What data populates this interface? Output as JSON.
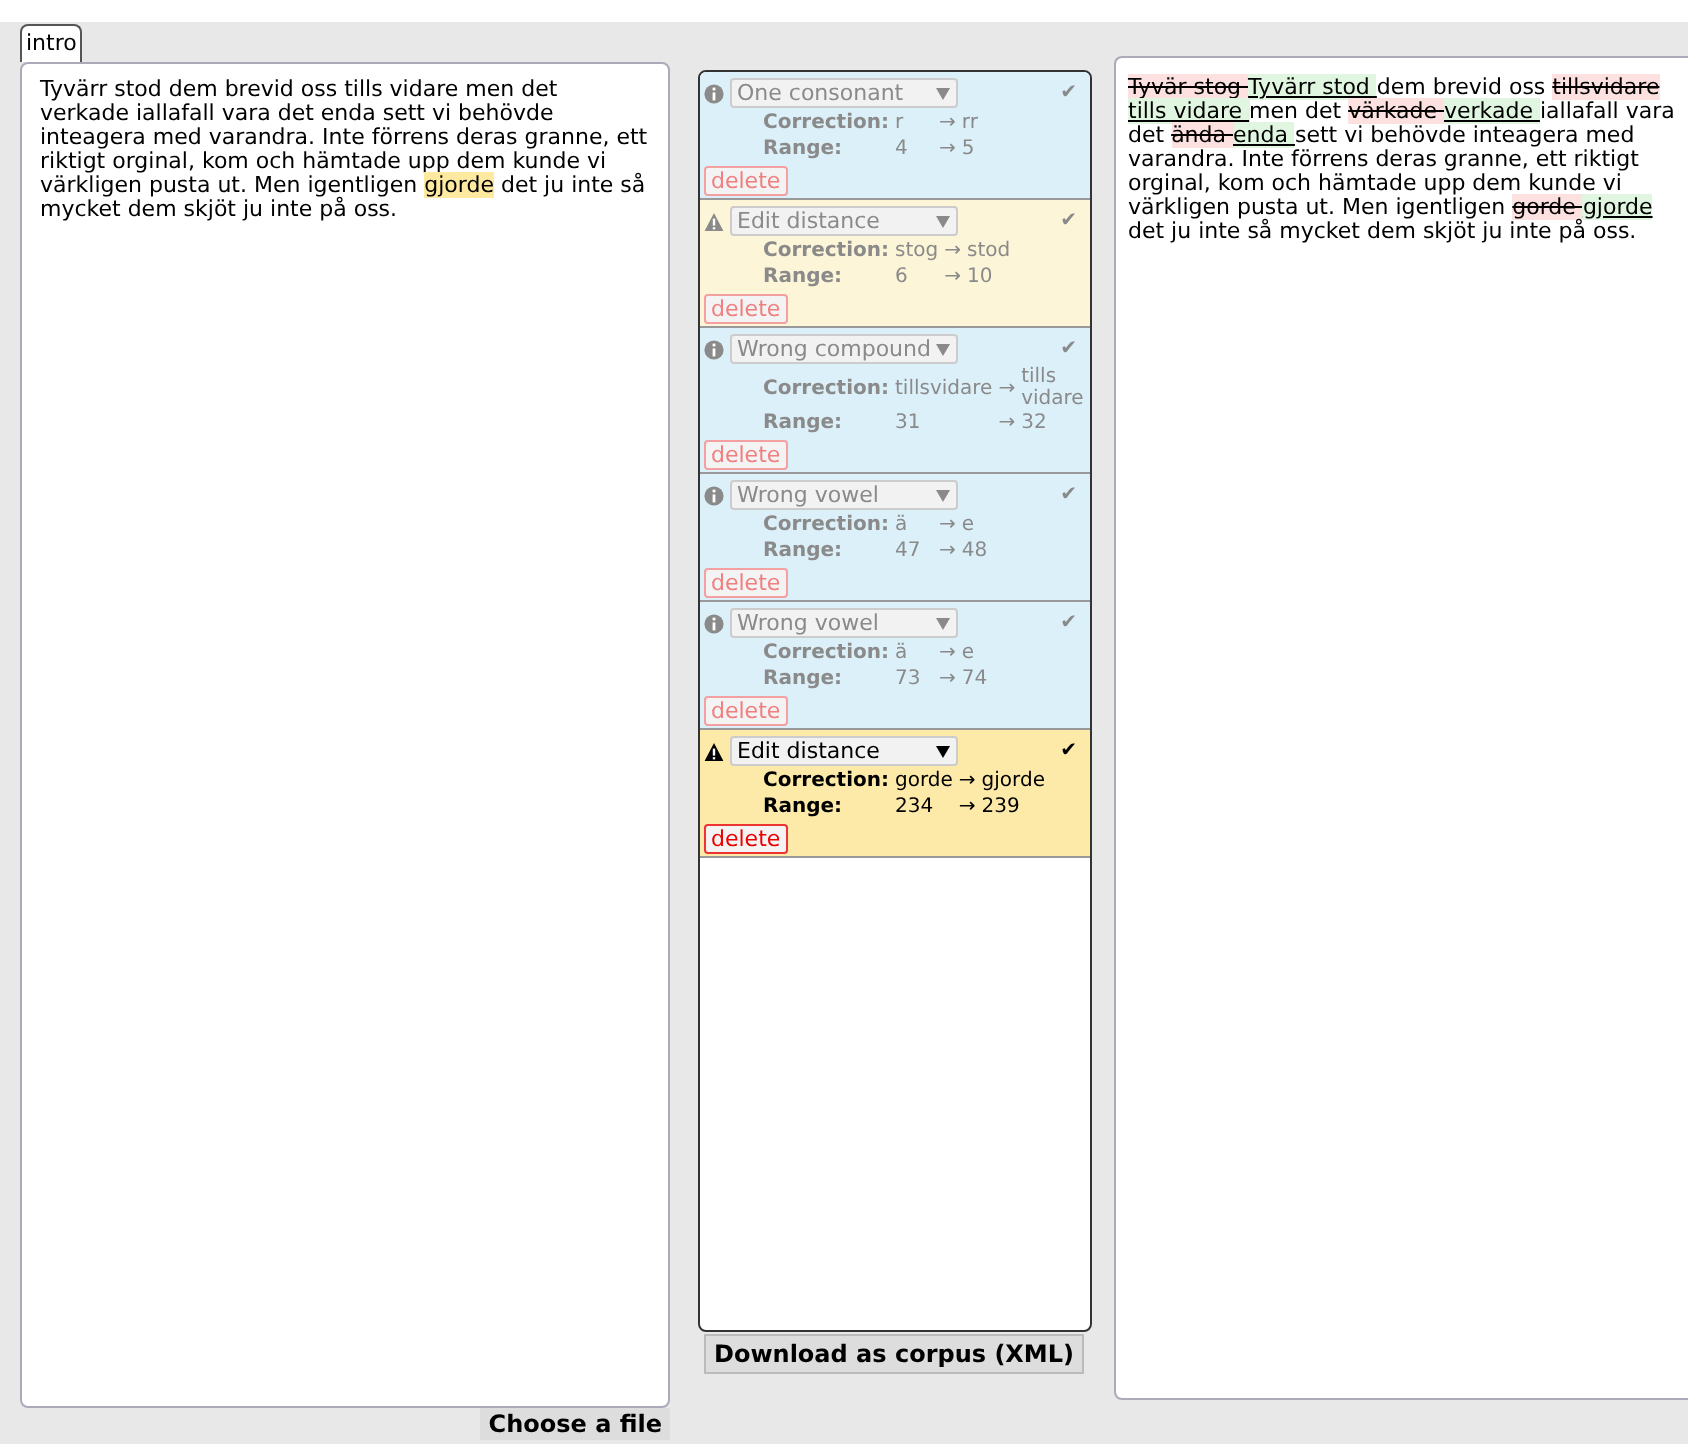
{
  "tab": {
    "label": "intro",
    "selected": true
  },
  "source_text": [
    {
      "text": "Tyvärr stod dem brevid oss tills vidare men det verkade iallafall vara det enda sett vi behövde inteagera med varandra. Inte förrens deras granne, ett riktigt orginal, kom och hämtade upp dem kunde vi värkligen pusta ut. Men igentligen ",
      "highlighted": false
    },
    {
      "text": "gjorde",
      "highlighted": true
    },
    {
      "text": " det ju inte så mycket dem skjöt ju inte på oss.",
      "highlighted": false
    }
  ],
  "choose_file_button": "Choose a file",
  "corrections": [
    {
      "kind": "info",
      "active": false,
      "type": "One consonant",
      "correction_label": "Correction:",
      "from": "r",
      "arrow": "→",
      "to": "rr",
      "range_label": "Range:",
      "start": "4",
      "range_arrow": "→",
      "end": "5",
      "delete": "delete",
      "check": "✔"
    },
    {
      "kind": "warning",
      "active": false,
      "type": "Edit distance",
      "correction_label": "Correction:",
      "from": "stog",
      "arrow": "→",
      "to": "stod",
      "range_label": "Range:",
      "start": "6",
      "range_arrow": "→",
      "end": "10",
      "delete": "delete",
      "check": "✔"
    },
    {
      "kind": "info",
      "active": false,
      "type": "Wrong compound",
      "correction_label": "Correction:",
      "from": "tillsvidare",
      "arrow": "→",
      "to": "tills vidare",
      "range_label": "Range:",
      "start": "31",
      "range_arrow": "→",
      "end": "32",
      "delete": "delete",
      "check": "✔"
    },
    {
      "kind": "info",
      "active": false,
      "type": "Wrong vowel",
      "correction_label": "Correction:",
      "from": "ä",
      "arrow": "→",
      "to": "e",
      "range_label": "Range:",
      "start": "47",
      "range_arrow": "→",
      "end": "48",
      "delete": "delete",
      "check": "✔"
    },
    {
      "kind": "info",
      "active": false,
      "type": "Wrong vowel",
      "correction_label": "Correction:",
      "from": "ä",
      "arrow": "→",
      "to": "e",
      "range_label": "Range:",
      "start": "73",
      "range_arrow": "→",
      "end": "74",
      "delete": "delete",
      "check": "✔"
    },
    {
      "kind": "warning",
      "active": true,
      "type": "Edit distance",
      "correction_label": "Correction:",
      "from": "gorde",
      "arrow": "→",
      "to": "gjorde",
      "range_label": "Range:",
      "start": "234",
      "range_arrow": "→",
      "end": "239",
      "delete": "delete",
      "check": "✔"
    }
  ],
  "download_button": "Download as corpus (XML)",
  "diff_text": [
    {
      "kind": "removed",
      "text": "Tyvär stog "
    },
    {
      "kind": "added",
      "text": "Tyvärr stod "
    },
    {
      "kind": "plain",
      "text": " dem brevid oss "
    },
    {
      "kind": "removed",
      "text": "tillsvidare "
    },
    {
      "kind": "added",
      "text": "tills vidare "
    },
    {
      "kind": "plain",
      "text": "men det "
    },
    {
      "kind": "removed",
      "text": "värkade "
    },
    {
      "kind": "added",
      "text": "verkade "
    },
    {
      "kind": "plain",
      "text": "iallafall vara det "
    },
    {
      "kind": "removed",
      "text": "ända "
    },
    {
      "kind": "added",
      "text": "enda "
    },
    {
      "kind": "plain",
      "text": "sett vi behövde inteagera med varandra. Inte förrens deras granne, ett riktigt orginal, kom och hämtade upp dem kunde vi värkligen pusta ut. Men igentligen "
    },
    {
      "kind": "removed",
      "text": "gorde "
    },
    {
      "kind": "added",
      "text": "gjorde "
    },
    {
      "kind": "plain",
      "text": "det ju inte så mycket dem skjöt ju inte på oss."
    }
  ]
}
